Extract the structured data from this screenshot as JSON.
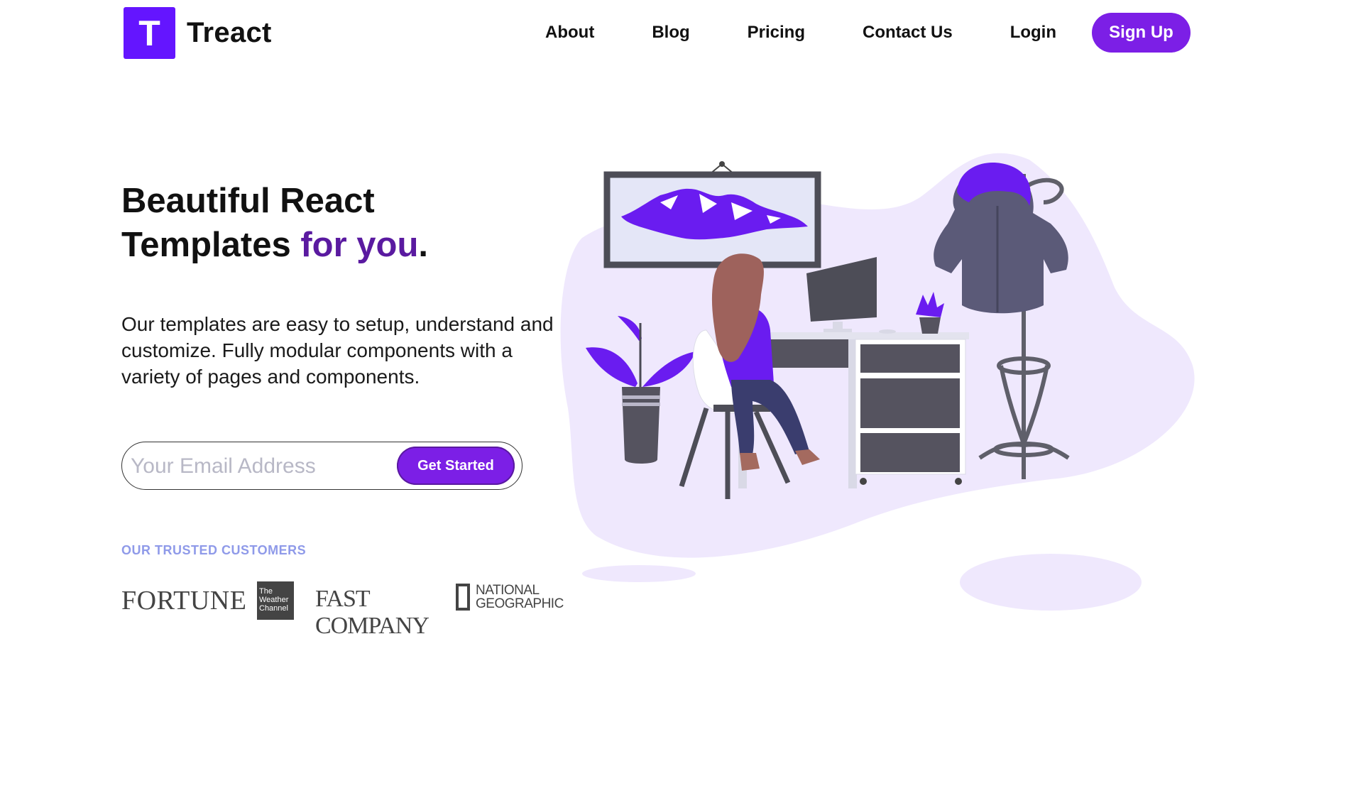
{
  "brand": {
    "logo_letter": "T",
    "name": "Treact",
    "accent_color": "#6415ff"
  },
  "nav": {
    "links": [
      "About",
      "Blog",
      "Pricing",
      "Contact Us",
      "Login"
    ],
    "signup_label": "Sign Up"
  },
  "hero": {
    "title_line1": "Beautiful React",
    "title_line2_start": "Templates ",
    "title_accent": "for you",
    "title_end": ".",
    "description": "Our templates are easy to setup, understand and customize. Fully modular components with a variety of pages and components.",
    "email_placeholder": "Your Email Address",
    "cta_label": "Get Started"
  },
  "customers": {
    "label": "OUR TRUSTED CUSTOMERS",
    "logos": {
      "fortune": "FORTUNE",
      "weather_line1": "The",
      "weather_line2": "Weather",
      "weather_line3": "Channel",
      "fastcompany": "FAST COMPANY",
      "natgeo_line1": "NATIONAL",
      "natgeo_line2": "GEOGRAPHIC"
    }
  },
  "colors": {
    "primary": "#7c1fe6",
    "accent_text": "#5a1aa0",
    "trusted_label": "#8f9ae9",
    "blob": "#efe8fd"
  }
}
